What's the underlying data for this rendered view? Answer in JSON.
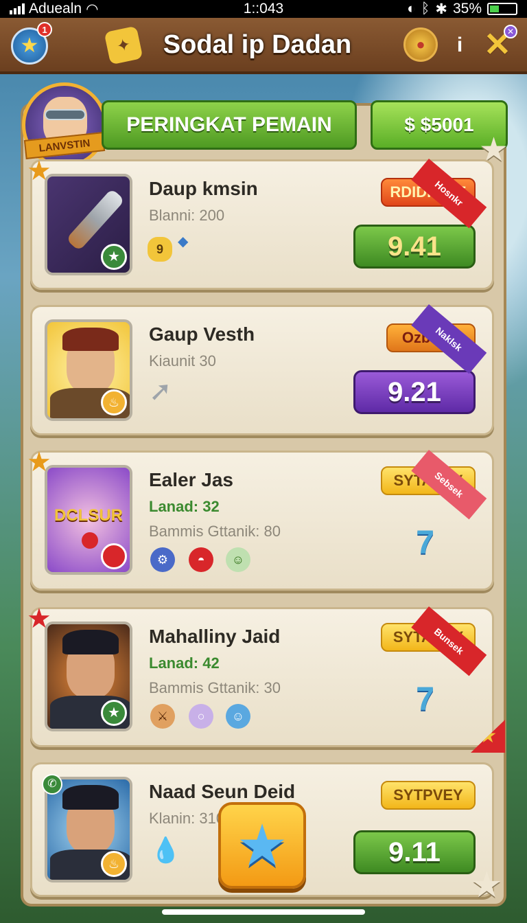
{
  "status": {
    "carrier": "Aduealn",
    "time": "1::043",
    "battery": "35%",
    "battery_level": 0.35
  },
  "topbar": {
    "title": "Sodal ip Dadan",
    "notif_count": "1",
    "info_label": "i",
    "icons": [
      "star-icon",
      "puzzle-icon",
      "coin-bag-icon",
      "info-icon",
      "close-icon"
    ]
  },
  "header": {
    "avatar_banner": "LANVSTIN",
    "ranking_label": "PERINGKAT PEMAIN",
    "currency_label": "$ $5001"
  },
  "players": [
    {
      "name": "Daup kmsin",
      "line1": "Blanni: 200",
      "tag": "RDIDISINE",
      "score": "9.41",
      "ribbon": "Hosnkr",
      "badge_num": "9",
      "score_color": "green"
    },
    {
      "name": "Gaup Vesth",
      "line1": "Kiaunit 30",
      "tag": "Ozbas 1",
      "score": "9.21",
      "ribbon": "Naklsk",
      "score_color": "purple"
    },
    {
      "name": "Ealer Jas",
      "line_green": "Lanad: 32",
      "line2": "Bammis Gttanik: 80",
      "tag": "SYTASEY",
      "ribbon": "Sebsek",
      "portrait_text": "DCLSUR"
    },
    {
      "name": "Mahalliny Jaid",
      "line_green": "Lanad: 42",
      "line2": "Bammis Gttanik: 30",
      "tag": "SYTAREY",
      "ribbon": "Bunsek"
    },
    {
      "name": "Naad Seun Deid",
      "line1": "Klanin: 310",
      "tag": "SYTPVEY",
      "score": "9.11",
      "score_color": "green"
    }
  ]
}
